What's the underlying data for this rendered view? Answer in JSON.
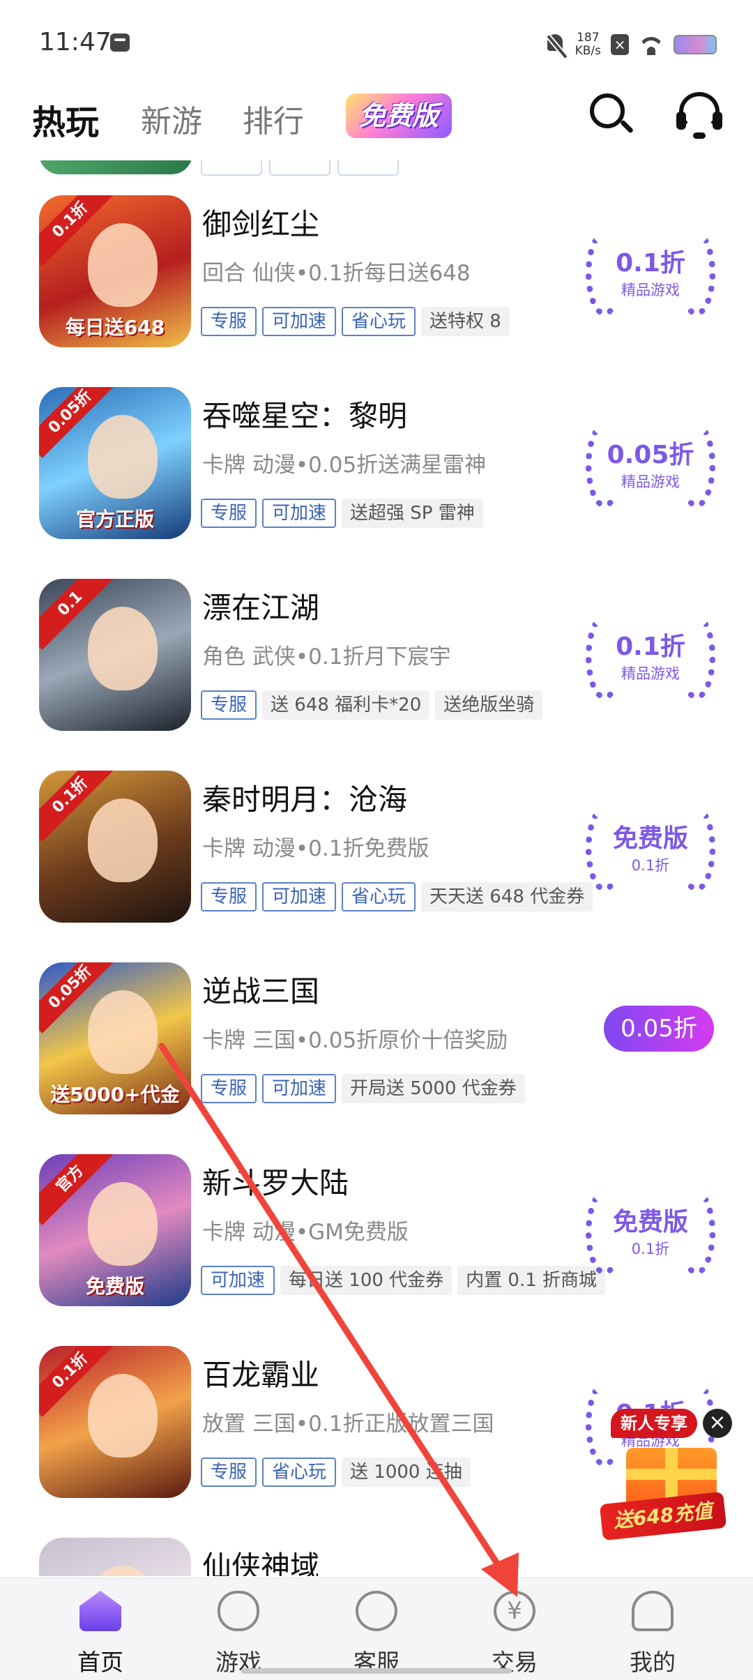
{
  "status": {
    "time": "11:47",
    "speed_value": "187",
    "speed_unit": "KB/s"
  },
  "header": {
    "tabs": [
      "热玩",
      "新游",
      "排行"
    ],
    "free_tab": "免费版"
  },
  "games": [
    {
      "name": "御剑红尘",
      "subtitle": "回合 仙侠•0.1折每日送648",
      "icon_ribbon": "0.1折",
      "icon_bottom": "每日送648",
      "tags": [
        {
          "text": "专服",
          "style": "blue"
        },
        {
          "text": "可加速",
          "style": "blue"
        },
        {
          "text": "省心玩",
          "style": "blue"
        },
        {
          "text": "送特权 8",
          "style": "gray"
        }
      ],
      "badge": {
        "type": "laurel",
        "main": "0.1折",
        "sub": "精品游戏"
      }
    },
    {
      "name": "吞噬星空：黎明",
      "subtitle": "卡牌 动漫•0.05折送满星雷神",
      "icon_ribbon": "0.05折",
      "icon_bottom": "官方正版",
      "tags": [
        {
          "text": "专服",
          "style": "blue"
        },
        {
          "text": "可加速",
          "style": "blue"
        },
        {
          "text": "送超强 SP 雷神",
          "style": "gray"
        }
      ],
      "badge": {
        "type": "laurel",
        "main": "0.05折",
        "sub": "精品游戏"
      }
    },
    {
      "name": "漂在江湖",
      "subtitle": "角色 武侠•0.1折月下宸宇",
      "icon_ribbon": "0.1",
      "icon_bottom": "",
      "tags": [
        {
          "text": "专服",
          "style": "blue"
        },
        {
          "text": "送 648 福利卡*20",
          "style": "gray"
        },
        {
          "text": "送绝版坐骑",
          "style": "gray"
        }
      ],
      "badge": {
        "type": "laurel",
        "main": "0.1折",
        "sub": "精品游戏"
      }
    },
    {
      "name": "秦时明月：沧海",
      "subtitle": "卡牌 动漫•0.1折免费版",
      "icon_ribbon": "0.1折",
      "icon_bottom": "",
      "tags": [
        {
          "text": "专服",
          "style": "blue"
        },
        {
          "text": "可加速",
          "style": "blue"
        },
        {
          "text": "省心玩",
          "style": "blue"
        },
        {
          "text": "天天送 648 代金券",
          "style": "gray"
        }
      ],
      "badge": {
        "type": "laurel",
        "main": "免费版",
        "sub": "0.1折"
      }
    },
    {
      "name": "逆战三国",
      "subtitle": "卡牌 三国•0.05折原价十倍奖励",
      "icon_ribbon": "0.05折",
      "icon_bottom": "送5000+代金",
      "tags": [
        {
          "text": "专服",
          "style": "blue"
        },
        {
          "text": "可加速",
          "style": "blue"
        },
        {
          "text": "开局送 5000 代金券",
          "style": "gray"
        }
      ],
      "badge": {
        "type": "pill",
        "main": "0.05折",
        "sub": ""
      }
    },
    {
      "name": "新斗罗大陆",
      "subtitle": "卡牌 动漫•GM免费版",
      "icon_ribbon": "官方",
      "icon_bottom": "免费版",
      "tags": [
        {
          "text": "可加速",
          "style": "blue"
        },
        {
          "text": "每日送 100 代金券",
          "style": "gray"
        },
        {
          "text": "内置 0.1 折商城",
          "style": "gray"
        }
      ],
      "badge": {
        "type": "laurel",
        "main": "免费版",
        "sub": "0.1折"
      }
    },
    {
      "name": "百龙霸业",
      "subtitle": "放置 三国•0.1折正版放置三国",
      "icon_ribbon": "0.1折",
      "icon_bottom": "",
      "tags": [
        {
          "text": "专服",
          "style": "blue"
        },
        {
          "text": "省心玩",
          "style": "blue"
        },
        {
          "text": "送 1000 连抽",
          "style": "gray"
        }
      ],
      "badge": {
        "type": "laurel",
        "main": "0.1折",
        "sub": "精品游戏"
      }
    },
    {
      "name": "仙侠神域",
      "subtitle": "",
      "icon_ribbon": "",
      "icon_bottom": "",
      "tags": [],
      "badge": {
        "type": "none",
        "main": "",
        "sub": ""
      }
    }
  ],
  "promo": {
    "title": "新人专享",
    "close": "×",
    "text": "送648充值"
  },
  "bottom_nav": [
    {
      "label": "首页",
      "icon": "home-icon"
    },
    {
      "label": "游戏",
      "icon": "gamepad-icon"
    },
    {
      "label": "客服",
      "icon": "customer-service-icon"
    },
    {
      "label": "交易",
      "icon": "yen-trade-icon",
      "glyph": "¥"
    },
    {
      "label": "我的",
      "icon": "profile-icon"
    }
  ],
  "colors": {
    "accent_purple": "#7d58e8",
    "tag_blue": "#3a63b8",
    "arrow_red": "#f0443a"
  }
}
